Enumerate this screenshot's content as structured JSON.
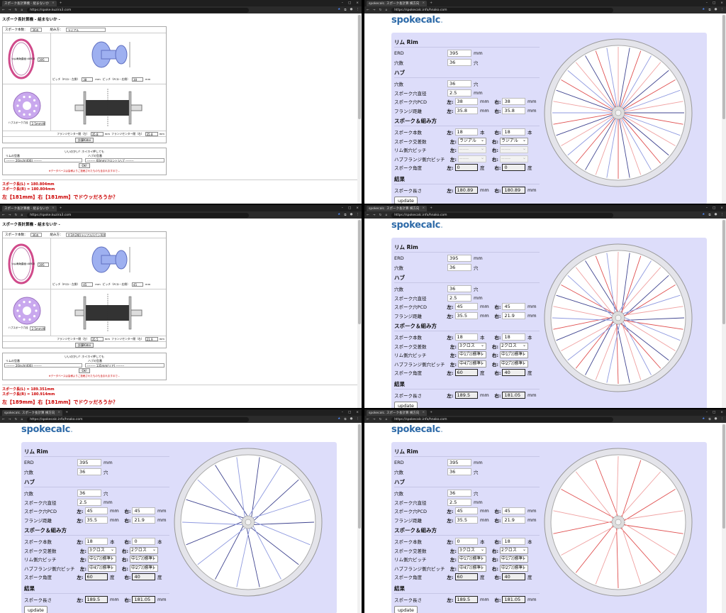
{
  "colors": {
    "red_spoke": "#e05050",
    "blue_spoke": "#404590",
    "light_blue": "#8f9ae0",
    "light_red": "#f0a0a0",
    "panel": "#ddddfa",
    "logo": "#2d6aa8"
  },
  "kuzira": {
    "tab_title": "スポーク長計算機 - 組まないか",
    "url": "https://spoke.kuzira3.com",
    "page_title": "スポーク長計算機 - 組まないか -",
    "label_spoke_count": "スポーク本数：",
    "label_pattern": "組み方：",
    "label_rim_erd": "リム有効直径（ERD）",
    "label_mm": "mm",
    "label_pitch_left": "ピッチ（PCD・左側）",
    "label_pitch_right": "ピッチ（PCD・右側）",
    "label_hub_hole": "ハブスポーク穴径",
    "label_flange_left": "フランジセンター間（左）",
    "label_flange_right": "フランジセンター間（右）",
    "calc_button": "計算Kidoi",
    "db_title": "いいのかい？ホイホイ押しても",
    "db_rim_label": "リムの型番",
    "db_hub_label": "ハブの型番",
    "db_button": "Ok!",
    "db_note": "※データベースは皆様よりご投稿されたものも含まれますので…",
    "tweet": "結果をツイートする",
    "shots": [
      {
        "count": "36本",
        "pattern": "ラジアル",
        "erd": "395",
        "pitch_l": "38",
        "pitch_r": "38",
        "hole": "2.5mm(標準)",
        "fl": "35.8",
        "fr": "35.8",
        "rim_select": "-------- 20inch(406) --------",
        "hub_select": "-------- 60mm(フロント)ハブ --------",
        "res_l": "スポーク長(L) = 180.804mm",
        "res_r": "スポーク長(R) = 180.804mm",
        "big": "左【181mm】右【181mm】でドウッだろうか？"
      },
      {
        "count": "36本",
        "pattern": "左3右2組(ラジアル)(パン形状)",
        "erd": "395",
        "pitch_l": "45",
        "pitch_r": "45",
        "hole": "2.5mm(標準)",
        "fl": "35.5",
        "fr": "21.9",
        "rim_select": "-------- 20inch(406) --------",
        "hub_select": "-------- 135mm(リア) --------",
        "res_l": "スポーク長(L) = 189.351mm",
        "res_r": "スポーク長(R) = 180.914mm",
        "big": "左【189mm】右【181mm】でドウッだろうか？"
      }
    ]
  },
  "spokecalc": {
    "tab_title": "spokecalc. スポーク長計算 横方向",
    "url": "https://spokecalc.info/hnako.com",
    "logo_main": "spokecalc",
    "logo_dot": ".",
    "sec_rim": "リム Rim",
    "sec_hub": "ハブ",
    "sec_spoke": "スポーク＆組み方",
    "sec_result": "結果",
    "l_erd": "ERD",
    "l_holes": "穴数",
    "l_spoke_hole": "スポーク穴直径",
    "l_pcd": "スポーク穴PCD",
    "l_flange": "フランジ距離",
    "l_count": "スポーク本数",
    "l_cross": "スポーク交差数",
    "l_rim_pitch": "リム側穴ピッチ",
    "l_hub_pitch": "ハブフランジ側穴ピッチ",
    "l_angle": "スポーク角度",
    "l_length": "スポーク長さ",
    "u_mm": "mm",
    "u_hole": "穴",
    "u_pcs": "本",
    "u_deg": "度",
    "left": "左:",
    "right": "右:",
    "update": "update",
    "shots": [
      {
        "erd": "395",
        "holes": "36",
        "hub_holes": "36",
        "spoke_hole": "2.5",
        "pcd_l": "38",
        "pcd_r": "38",
        "fl_l": "35.8",
        "fl_r": "35.8",
        "cnt_l": "18",
        "cnt_r": "18",
        "cross_l": "ラジアル",
        "cross_r": "ラジアル",
        "rp_l": "------",
        "rp_r": "------",
        "hp_l": "------",
        "hp_r": "------",
        "ang_l": "0",
        "ang_r": "0",
        "len_l": "180.89",
        "len_r": "180.89",
        "dis": true
      },
      {
        "erd": "395",
        "holes": "36",
        "hub_holes": "36",
        "spoke_hole": "2.5",
        "pcd_l": "45",
        "pcd_r": "45",
        "fl_l": "35.5",
        "fl_r": "21.9",
        "cnt_l": "18",
        "cnt_r": "18",
        "cross_l": "3クロス",
        "cross_r": "2クロス",
        "rp_l": "中1穴(標準)",
        "rp_r": "中1穴(標準)",
        "hp_l": "中4穴(標準)",
        "hp_r": "中2穴(標準)",
        "ang_l": "60",
        "ang_r": "40",
        "len_l": "189.5",
        "len_r": "181.05",
        "dis": false
      },
      {
        "erd": "395",
        "holes": "36",
        "hub_holes": "36",
        "spoke_hole": "2.5",
        "pcd_l": "45",
        "pcd_r": "45",
        "fl_l": "35.5",
        "fl_r": "21.9",
        "cnt_l": "18",
        "cnt_r": "0",
        "cross_l": "3クロス",
        "cross_r": "2クロス",
        "rp_l": "中1穴(標準)",
        "rp_r": "中1穴(標準)",
        "hp_l": "中4穴(標準)",
        "hp_r": "中2穴(標準)",
        "ang_l": "60",
        "ang_r": "40",
        "len_l": "189.5",
        "len_r": "181.05",
        "dis": false
      },
      {
        "erd": "395",
        "holes": "36",
        "hub_holes": "36",
        "spoke_hole": "2.5",
        "pcd_l": "45",
        "pcd_r": "45",
        "fl_l": "35.5",
        "fl_r": "21.9",
        "cnt_l": "0",
        "cnt_r": "18",
        "cross_l": "3クロス",
        "cross_r": "2クロス",
        "rp_l": "中1穴(標準)",
        "rp_r": "中1穴(標準)",
        "hp_l": "中4穴(標準)",
        "hp_r": "中2穴(標準)",
        "ang_l": "60",
        "ang_r": "40",
        "len_l": "189.5",
        "len_r": "181.05",
        "dis": false
      }
    ]
  }
}
